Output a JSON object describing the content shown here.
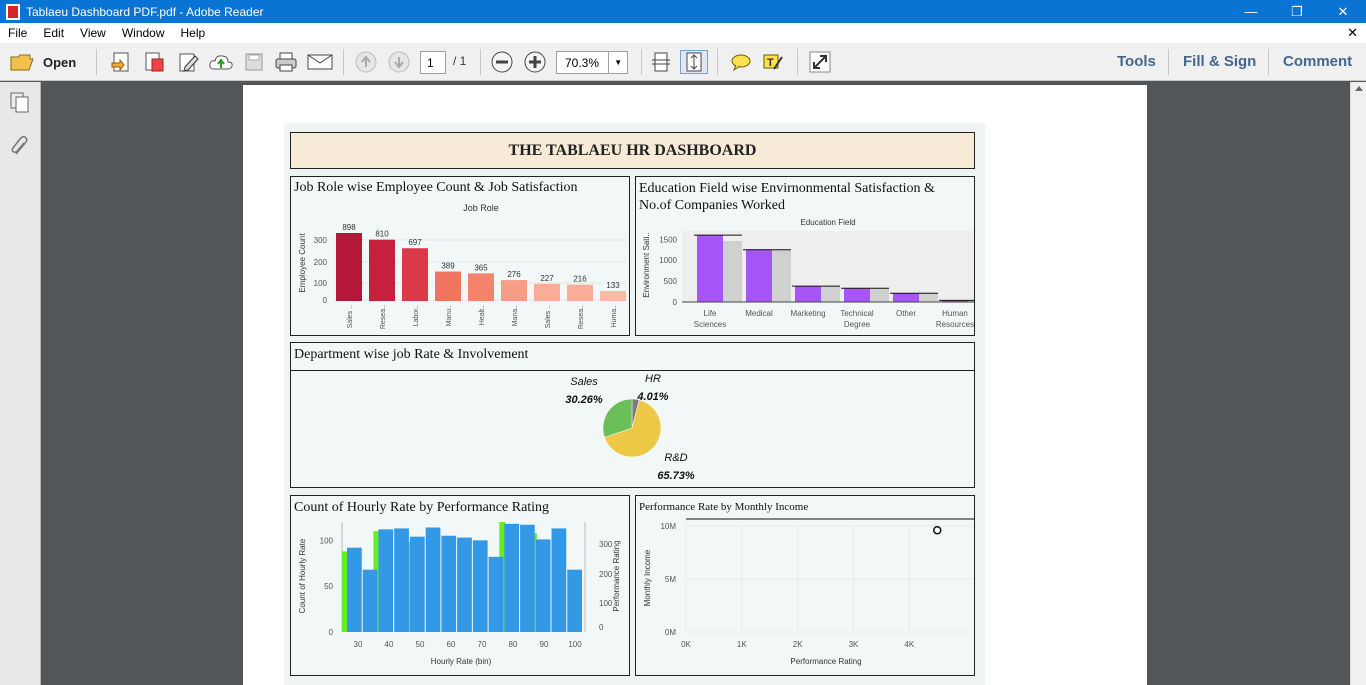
{
  "window": {
    "title": "Tablaeu Dashboard PDF.pdf - Adobe Reader"
  },
  "menu": [
    "File",
    "Edit",
    "View",
    "Window",
    "Help"
  ],
  "toolbar": {
    "open_label": "Open",
    "page_current": "1",
    "page_total": "/ 1",
    "zoom": "70.3%",
    "tools_label": "Tools",
    "fillsign_label": "Fill & Sign",
    "comment_label": "Comment"
  },
  "dashboard": {
    "title": "THE TABLAEU HR DASHBOARD",
    "panel1_title": "Job Role wise Employee Count & Job Satisfaction",
    "panel2_title_line1": "Education Field wise Envirnonmental Satisfaction &",
    "panel2_title_line2": "No.of Companies Worked",
    "panel3_title": "Department wise job Rate & Involvement",
    "panel4_title": "Count of Hourly Rate by Performance Rating",
    "panel5_title": "Performance Rate by Monthly Income"
  },
  "chart_data": [
    {
      "type": "bar",
      "title": "Job Role",
      "ylabel": "Employee Count",
      "categories": [
        "Sales ..",
        "Resea..",
        "Labor..",
        "Manu..",
        "Healt..",
        "Mana..",
        "Sales ..",
        "Resea..",
        "Huma.."
      ],
      "values": [
        898,
        810,
        697,
        389,
        365,
        276,
        227,
        216,
        133
      ],
      "yticks": [
        "300",
        "200",
        "100",
        "0"
      ],
      "colors": [
        "#b5173a",
        "#c81f3d",
        "#db3848",
        "#f07560",
        "#f5826d",
        "#f79d85",
        "#f9ad97",
        "#f9ad97",
        "#fbbba7"
      ]
    },
    {
      "type": "bar",
      "title": "Education Field",
      "ylabel": "Environment Sati..",
      "categories": [
        "Life Sciences",
        "Medical",
        "Marketing",
        "Technical Degree",
        "Other",
        "Human Resources"
      ],
      "values": [
        1600,
        1250,
        380,
        330,
        210,
        40
      ],
      "yticks": [
        "1500",
        "1000",
        "500",
        "0"
      ],
      "ylim": [
        0,
        1700
      ],
      "color": "#a855f7"
    },
    {
      "type": "pie",
      "title": "",
      "labels": [
        "Sales",
        "HR",
        "R&D"
      ],
      "values": [
        30.26,
        4.01,
        65.73
      ],
      "value_labels": [
        "30.26%",
        "4.01%",
        "65.73%"
      ],
      "colors": [
        "#6bbf59",
        "#7a7a7a",
        "#ecc846"
      ]
    },
    {
      "type": "bar",
      "xlabel": "Hourly Rate (bin)",
      "ylabel": "Count of Hourly Rate",
      "ylabel_right": "Performance Rating",
      "x_ticks": [
        "30",
        "40",
        "50",
        "60",
        "70",
        "80",
        "90",
        "100"
      ],
      "yticks_left": [
        "100",
        "50",
        "0"
      ],
      "yticks_right": [
        "300",
        "200",
        "100",
        "0"
      ],
      "series": [
        {
          "name": "Count of Hourly Rate",
          "color": "#3399e6",
          "values": [
            92,
            68,
            112,
            113,
            104,
            114,
            105,
            103,
            100,
            82,
            118,
            117,
            101,
            113,
            68
          ]
        },
        {
          "name": "Performance Rating",
          "color": "#66ee22",
          "values": [
            88,
            0,
            110,
            0,
            98,
            0,
            0,
            0,
            0,
            0,
            120,
            0,
            108,
            0,
            0
          ]
        }
      ],
      "ylim": [
        0,
        120
      ]
    },
    {
      "type": "scatter",
      "xlabel": "Performance Rating",
      "ylabel": "Monthly Income",
      "x_ticks": [
        "0K",
        "1K",
        "2K",
        "3K",
        "4K"
      ],
      "y_ticks": [
        "10M",
        "5M",
        "0M"
      ],
      "points": [
        {
          "x": 4500,
          "y": 9600000
        }
      ],
      "xlim": [
        0,
        4800
      ],
      "ylim": [
        0,
        10000000
      ]
    }
  ]
}
